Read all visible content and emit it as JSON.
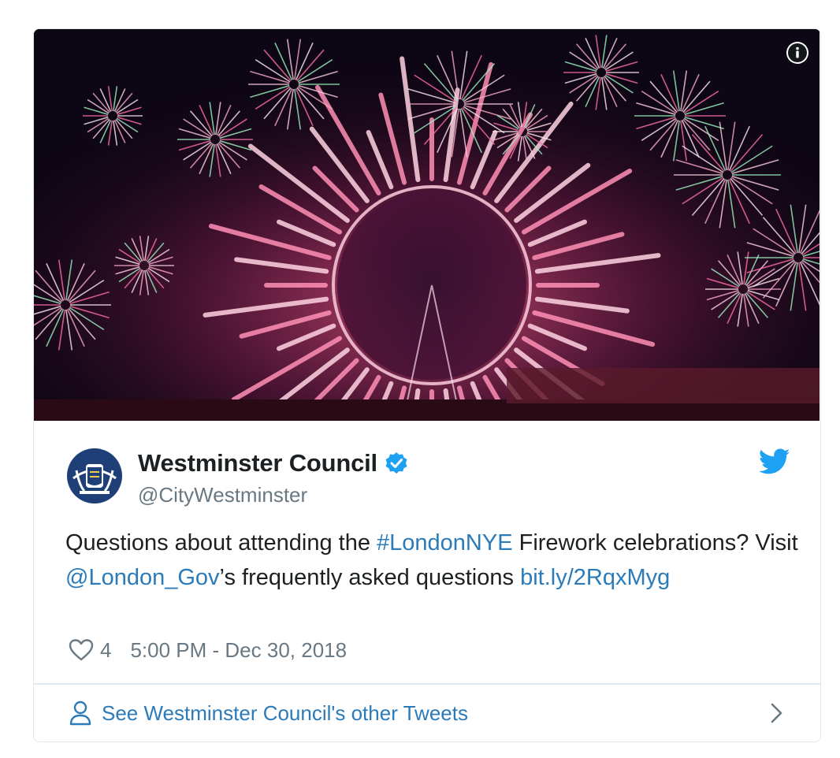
{
  "media": {
    "alt_icon": "info-icon"
  },
  "author": {
    "display_name": "Westminster Council",
    "screen_name": "@CityWestminster",
    "verified_icon": "verified-badge-icon",
    "avatar_icon": "westminster-crest-icon"
  },
  "brand": {
    "logo_icon": "twitter-bird-icon",
    "accent": "#1da1f2",
    "link": "#2b7bb9"
  },
  "tweet": {
    "text_1": "Questions about attending the ",
    "hashtag": "#LondonNYE",
    "text_2": " Firework celebrations? Visit ",
    "mention": "@London_Gov",
    "text_3": "’s frequently asked questions ",
    "url": "bit.ly/2RqxMyg"
  },
  "meta": {
    "like_icon": "heart-icon",
    "like_count": "4",
    "timestamp": "5:00 PM - Dec 30, 2018"
  },
  "footer": {
    "icon": "person-icon",
    "label": "See Westminster Council's other Tweets",
    "chevron_icon": "chevron-right-icon"
  }
}
